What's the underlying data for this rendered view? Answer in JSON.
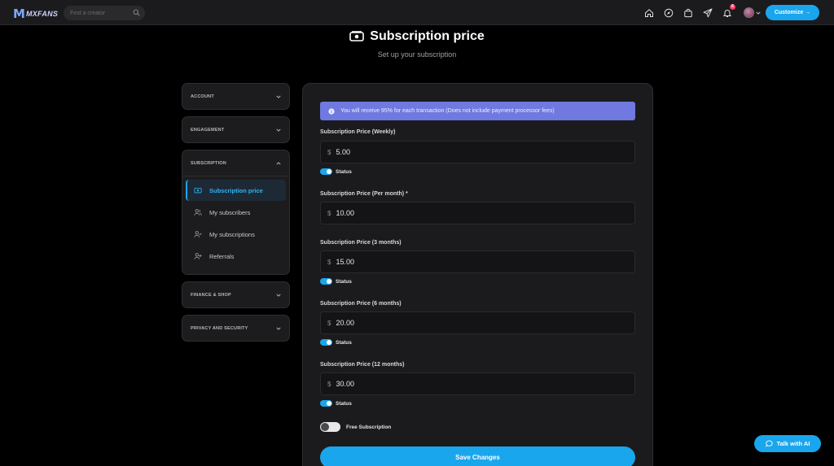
{
  "brand": {
    "mark": "M",
    "name": "MXFANS"
  },
  "search": {
    "placeholder": "Find a creator",
    "icon": "search-icon"
  },
  "nav": {
    "icons": [
      "home-icon",
      "compass-icon",
      "bag-icon",
      "send-icon",
      "bell-icon"
    ],
    "notification_count": "6",
    "customize_label": "Customize →"
  },
  "header": {
    "title": "Subscription price",
    "subtitle": "Set up your subscription"
  },
  "sidebar": {
    "sections": [
      {
        "label": "ACCOUNT",
        "expanded": false
      },
      {
        "label": "ENGAGEMENT",
        "expanded": false
      },
      {
        "label": "SUBSCRIPTION",
        "expanded": true
      },
      {
        "label": "FINANCE & SHOP",
        "expanded": false
      },
      {
        "label": "PRIVACY AND SECURITY",
        "expanded": false
      }
    ],
    "subscription_items": [
      {
        "label": "Subscription price",
        "icon": "cash-icon",
        "active": true
      },
      {
        "label": "My subscribers",
        "icon": "users-icon",
        "active": false
      },
      {
        "label": "My subscriptions",
        "icon": "user-check-icon",
        "active": false
      },
      {
        "label": "Referrals",
        "icon": "user-plus-icon",
        "active": false
      }
    ]
  },
  "main": {
    "info": "You will receive 95% for each transaction (Does not include payment processor fees)",
    "currency": "$",
    "fields": [
      {
        "label": "Subscription Price (Weekly)",
        "value": "5.00",
        "status": true
      },
      {
        "label": "Subscription Price (Per month) *",
        "value": "10.00"
      },
      {
        "label": "Subscription Price (3 months)",
        "value": "15.00",
        "status": true
      },
      {
        "label": "Subscription Price (6 months)",
        "value": "20.00",
        "status": true
      },
      {
        "label": "Subscription Price (12 months)",
        "value": "30.00",
        "status": true
      }
    ],
    "status_label": "Status",
    "free_subscription_label": "Free Subscription",
    "free_subscription_on": false,
    "save_label": "Save Changes"
  },
  "ai": {
    "label": "Talk with AI"
  },
  "colors": {
    "accent": "#1aa6ec",
    "info_bg": "#6f79e0",
    "card_bg": "#1b1b1d",
    "page_bg": "#000000"
  }
}
